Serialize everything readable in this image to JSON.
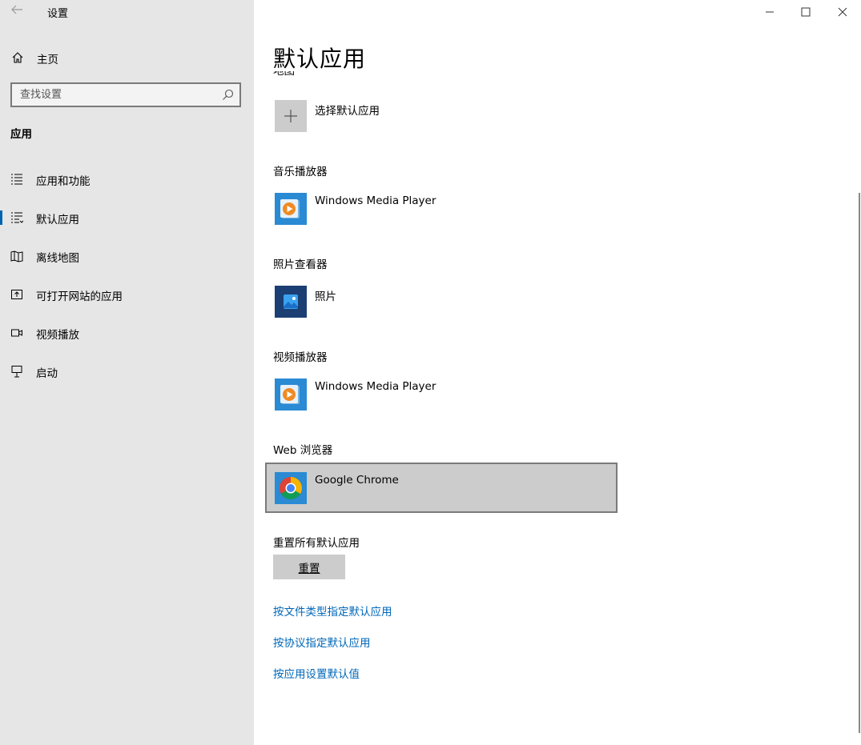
{
  "window": {
    "title": "设置",
    "controls": {
      "minimize": "minimize",
      "maximize": "maximize",
      "close": "close"
    }
  },
  "sidebar": {
    "home_label": "主页",
    "search_placeholder": "查找设置",
    "section_title": "应用",
    "items": [
      {
        "label": "应用和功能",
        "icon": "apps-list-icon",
        "selected": false
      },
      {
        "label": "默认应用",
        "icon": "default-apps-icon",
        "selected": true
      },
      {
        "label": "离线地图",
        "icon": "offline-map-icon",
        "selected": false
      },
      {
        "label": "可打开网站的应用",
        "icon": "website-apps-icon",
        "selected": false
      },
      {
        "label": "视频播放",
        "icon": "video-playback-icon",
        "selected": false
      },
      {
        "label": "启动",
        "icon": "startup-icon",
        "selected": false
      }
    ]
  },
  "main": {
    "page_title": "默认应用",
    "clipped_label": "地图",
    "maps_app": "选择默认应用",
    "music_label": "音乐播放器",
    "music_app": "Windows Media Player",
    "photo_label": "照片查看器",
    "photo_app": "照片",
    "video_label": "视频播放器",
    "video_app": "Windows Media Player",
    "browser_label": "Web 浏览器",
    "browser_app": "Google Chrome",
    "reset_label": "重置所有默认应用",
    "reset_button": "重置",
    "links": [
      "按文件类型指定默认应用",
      "按协议指定默认应用",
      "按应用设置默认值"
    ]
  },
  "colors": {
    "sidebar_bg": "#e6e6e6",
    "accent": "#0063b1",
    "link": "#0067b8",
    "selected_bg": "#cccccc",
    "wmp_tile": "#2a8ad4",
    "photos_tile": "#1b3f73"
  }
}
